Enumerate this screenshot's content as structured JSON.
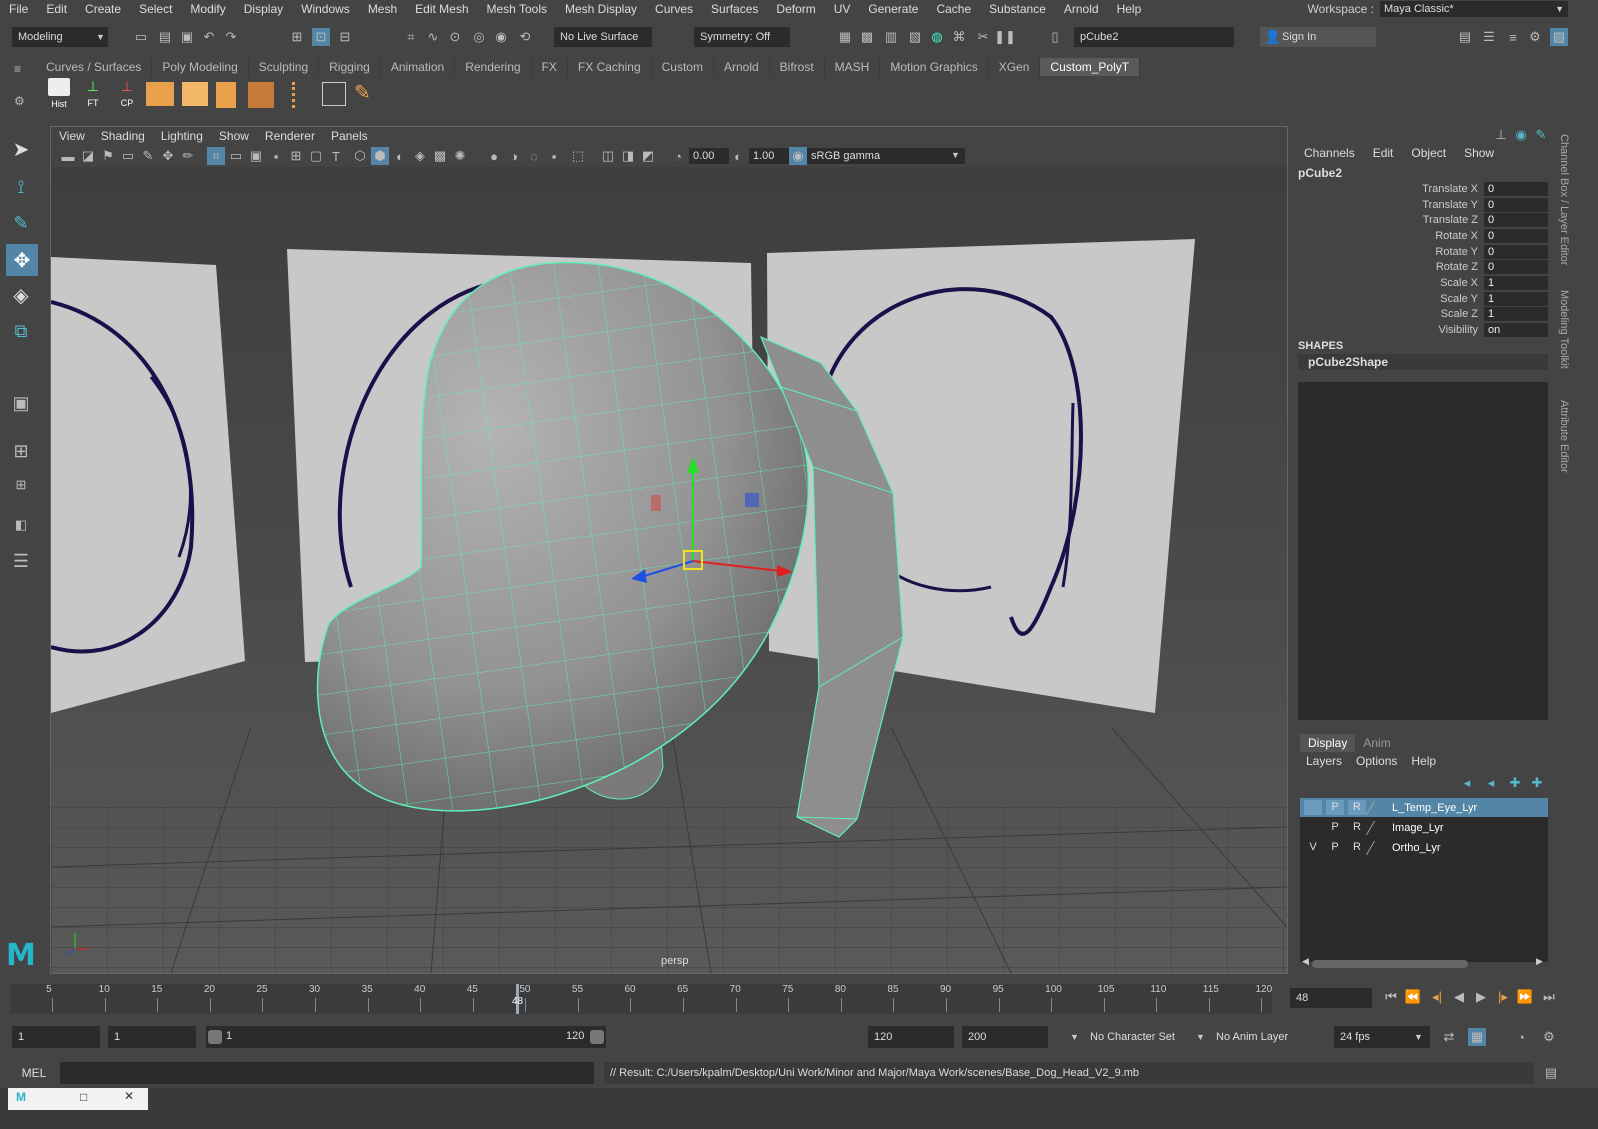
{
  "menus": [
    "File",
    "Edit",
    "Create",
    "Select",
    "Modify",
    "Display",
    "Windows",
    "Mesh",
    "Edit Mesh",
    "Mesh Tools",
    "Mesh Display",
    "Curves",
    "Surfaces",
    "Deform",
    "UV",
    "Generate",
    "Cache",
    "Substance",
    "Arnold",
    "Help"
  ],
  "workspace": {
    "label": "Workspace :",
    "value": "Maya Classic*"
  },
  "status": {
    "mode": "Modeling",
    "live_surface": "No Live Surface",
    "symmetry": "Symmetry: Off",
    "object_field": "pCube2",
    "sign_in": "Sign In"
  },
  "shelf": {
    "tabs": [
      "Curves / Surfaces",
      "Poly Modeling",
      "Sculpting",
      "Rigging",
      "Animation",
      "Rendering",
      "FX",
      "FX Caching",
      "Custom",
      "Arnold",
      "Bifrost",
      "MASH",
      "Motion Graphics",
      "XGen",
      "Custom_PolyT"
    ],
    "active_tab": "Custom_PolyT",
    "buttons": [
      "Hist",
      "FT",
      "CP"
    ]
  },
  "viewport": {
    "menus": [
      "View",
      "Shading",
      "Lighting",
      "Show",
      "Renderer",
      "Panels"
    ],
    "exposure": "0.00",
    "gamma": "1.00",
    "color_space": "sRGB gamma",
    "camera_label": "persp"
  },
  "channel_box": {
    "menus": [
      "Channels",
      "Edit",
      "Object",
      "Show"
    ],
    "object": "pCube2",
    "attributes": [
      {
        "name": "Translate X",
        "value": "0"
      },
      {
        "name": "Translate Y",
        "value": "0"
      },
      {
        "name": "Translate Z",
        "value": "0"
      },
      {
        "name": "Rotate X",
        "value": "0"
      },
      {
        "name": "Rotate Y",
        "value": "0"
      },
      {
        "name": "Rotate Z",
        "value": "0"
      },
      {
        "name": "Scale X",
        "value": "1"
      },
      {
        "name": "Scale Y",
        "value": "1"
      },
      {
        "name": "Scale Z",
        "value": "1"
      },
      {
        "name": "Visibility",
        "value": "on"
      }
    ],
    "shapes_header": "SHAPES",
    "shape_name": "pCube2Shape"
  },
  "side_tabs": [
    "Channel Box / Layer Editor",
    "Modeling Toolkit",
    "Attribute Editor"
  ],
  "layer_editor": {
    "tabs": [
      "Display",
      "Anim"
    ],
    "menus": [
      "Layers",
      "Options",
      "Help"
    ],
    "layers": [
      {
        "v": "",
        "p": "P",
        "r": "R",
        "name": "L_Temp_Eye_Lyr",
        "selected": true
      },
      {
        "v": "",
        "p": "P",
        "r": "R",
        "name": "Image_Lyr",
        "selected": false
      },
      {
        "v": "V",
        "p": "P",
        "r": "R",
        "name": "Ortho_Lyr",
        "selected": false
      }
    ]
  },
  "timeline": {
    "ticks": [
      "5",
      "10",
      "15",
      "20",
      "25",
      "30",
      "35",
      "40",
      "45",
      "50",
      "55",
      "60",
      "65",
      "70",
      "75",
      "80",
      "85",
      "90",
      "95",
      "100",
      "105",
      "110",
      "115",
      "120"
    ],
    "current": "48",
    "current_field": "48"
  },
  "range": {
    "start": "1",
    "playback_start": "1",
    "slider_start": "1",
    "slider_end": "120",
    "playback_end": "120",
    "end": "200",
    "character_set": "No Character Set",
    "anim_layer": "No Anim Layer",
    "fps": "24 fps"
  },
  "command_line": {
    "label": "MEL",
    "result": "// Result: C:/Users/kpalm/Desktop/Uni Work/Minor and Major/Maya Work/scenes/Base_Dog_Head_V2_9.mb"
  },
  "colors": {
    "accent": "#5285a6",
    "wire": "#5ff0b4",
    "ink": "#1c0f4a"
  }
}
